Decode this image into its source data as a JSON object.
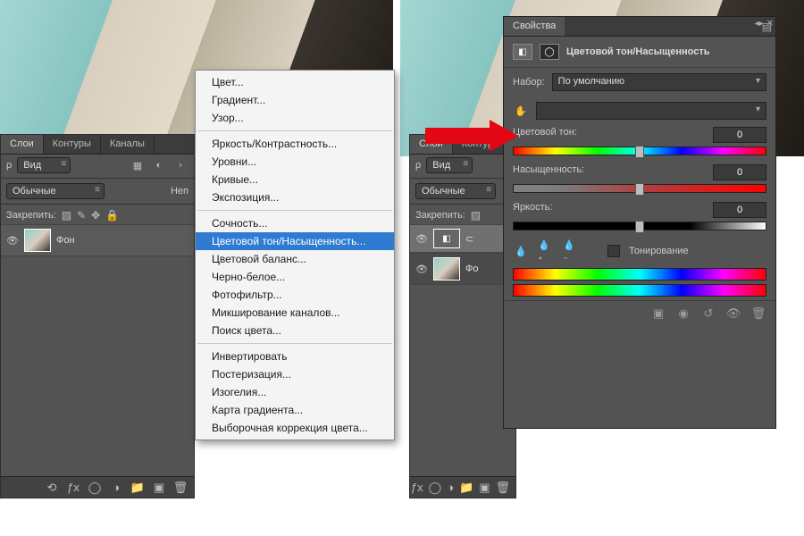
{
  "layers_panel": {
    "tabs": [
      "Слои",
      "Контуры",
      "Каналы"
    ],
    "filter_label": "Вид",
    "blend_mode": "Обычные",
    "opacity_label": "Неп",
    "lock_label": "Закрепить:",
    "background_layer": "Фон",
    "adjustment_layer_short": "Фо"
  },
  "menu": {
    "items_top": [
      "Цвет...",
      "Градиент...",
      "Узор..."
    ],
    "items_adjust": [
      "Яркость/Контрастность...",
      "Уровни...",
      "Кривые...",
      "Экспозиция..."
    ],
    "items_color": [
      "Сочность...",
      "Цветовой тон/Насыщенность...",
      "Цветовой баланс...",
      "Черно-белое...",
      "Фотофильтр...",
      "Микширование каналов...",
      "Поиск цвета..."
    ],
    "items_other": [
      "Инвертировать",
      "Постеризация...",
      "Изогелия...",
      "Карта градиента...",
      "Выборочная коррекция цвета..."
    ],
    "highlighted": "Цветовой тон/Насыщенность..."
  },
  "properties": {
    "tab": "Свойства",
    "title": "Цветовой тон/Насыщенность",
    "preset_label": "Набор:",
    "preset_value": "По умолчанию",
    "hue_label": "Цветовой тон:",
    "hue_value": "0",
    "sat_label": "Насыщенность:",
    "sat_value": "0",
    "lig_label": "Яркость:",
    "lig_value": "0",
    "colorize_label": "Тонирование"
  }
}
